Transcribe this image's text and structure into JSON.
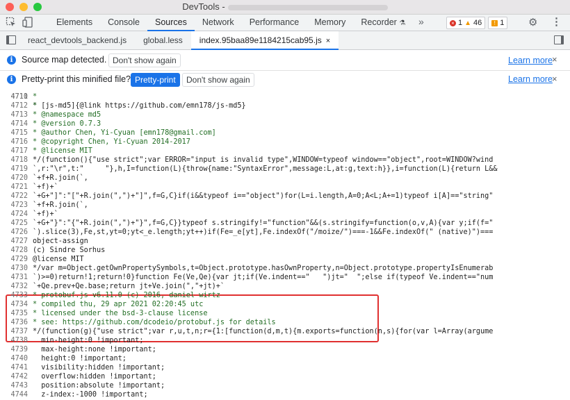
{
  "window": {
    "title": "DevTools -",
    "traffic_lights": [
      "#fd5f57",
      "#febc2e",
      "#28c840"
    ]
  },
  "toolbar": {
    "tabs": [
      "Elements",
      "Console",
      "Sources",
      "Network",
      "Performance",
      "Memory",
      "Recorder"
    ],
    "active_tab": "Sources",
    "more": "»",
    "error_count": "1",
    "warning_count": "46",
    "issue_count": "1"
  },
  "file_tabs": {
    "items": [
      "react_devtools_backend.js",
      "global.less",
      "index.95baa89e1184215cab95.js"
    ],
    "active": "index.95baa89e1184215cab95.js",
    "close": "×"
  },
  "sourcemap_bar": {
    "message": "Source map detected.",
    "dismiss": "Don't show again",
    "learn_more": "Learn more",
    "close": "×"
  },
  "prettyprint_bar": {
    "message": "Pretty-print this minified file?",
    "action": "Pretty-print",
    "dismiss": "Don't show again",
    "learn_more": "Learn more",
    "close": "×"
  },
  "code": {
    "partial_line": "* [js-md5]{@link https://github.com/emn178/js-md5}",
    "lines": [
      {
        "n": "4711",
        "t": "*"
      },
      {
        "n": "4712",
        "t": "*"
      },
      {
        "n": "4713",
        "t": "* @namespace md5"
      },
      {
        "n": "4714",
        "t": "* @version 0.7.3"
      },
      {
        "n": "4715",
        "t": "* @author Chen, Yi-Cyuan [emn178@gmail.com]"
      },
      {
        "n": "4716",
        "t": "* @copyright Chen, Yi-Cyuan 2014-2017"
      },
      {
        "n": "4717",
        "t": "* @license MIT"
      },
      {
        "n": "4718",
        "t": "*/(function(){\"use strict\";var ERROR=\"input is invalid type\",WINDOW=typeof window==\"object\",root=WINDOW?wind"
      },
      {
        "n": "4719",
        "t": "`,r:\"\\r\",t:\"     \"},h,I=function(L){throw{name:\"SyntaxError\",message:L,at:g,text:h}},i=function(L){return L&&"
      },
      {
        "n": "4720",
        "t": "`+f+R.join(`,"
      },
      {
        "n": "4721",
        "t": "`+f)+`"
      },
      {
        "n": "4722",
        "t": "`+G+\"]\":\"[\"+R.join(\",\")+\"]\",f=G,C}if(i&&typeof i==\"object\")for(L=i.length,A=0;A<L;A+=1)typeof i[A]==\"string\""
      },
      {
        "n": "4723",
        "t": "`+f+R.join(`,"
      },
      {
        "n": "4724",
        "t": "`+f)+`"
      },
      {
        "n": "4725",
        "t": "`+G+\"}\":\"{\"+R.join(\",\")+\"}\",f=G,C}}typeof s.stringify!=\"function\"&&(s.stringify=function(o,v,A){var y;if(f=\""
      },
      {
        "n": "4726",
        "t": "`).slice(3),Fe,st,yt=0;yt<_e.length;yt++)if(Fe=_e[yt],Fe.indexOf(\"/moize/\")===-1&&Fe.indexOf(\" (native)\")==="
      },
      {
        "n": "4727",
        "t": "object-assign"
      },
      {
        "n": "4728",
        "t": "(c) Sindre Sorhus"
      },
      {
        "n": "4729",
        "t": "@license MIT"
      },
      {
        "n": "4730",
        "t": "*/var m=Object.getOwnPropertySymbols,t=Object.prototype.hasOwnProperty,n=Object.prototype.propertyIsEnumerab"
      },
      {
        "n": "4731",
        "t": "`)>=0)return!1;return!0}function Fe(Ve,Qe){var jt;if(Ve.indent==\"   \")jt=\"  \";else if(typeof Ve.indent==\"num"
      },
      {
        "n": "4732",
        "t": "`+Qe.prev+Qe.base;return jt+Ve.join(\",\"+jt)+`"
      },
      {
        "n": "4733",
        "t": "* protobuf.js v6.11.0 (c) 2016, daniel wirtz"
      },
      {
        "n": "4734",
        "t": "* compiled thu, 29 apr 2021 02:20:45 utc"
      },
      {
        "n": "4735",
        "t": "* licensed under the bsd-3-clause license"
      },
      {
        "n": "4736",
        "t": "* see: https://github.com/dcodeio/protobuf.js for details"
      },
      {
        "n": "4737",
        "t": "*/(function(g){\"use strict\";var r,u,t,n;r={1:[function(d,m,t){m.exports=function(n,s){for(var l=Array(argume"
      },
      {
        "n": "4738",
        "t": "  min-height:0 !important;"
      },
      {
        "n": "4739",
        "t": "  max-height:none !important;"
      },
      {
        "n": "4740",
        "t": "  height:0 !important;"
      },
      {
        "n": "4741",
        "t": "  visibility:hidden !important;"
      },
      {
        "n": "4742",
        "t": "  overflow:hidden !important;"
      },
      {
        "n": "4743",
        "t": "  position:absolute !important;"
      },
      {
        "n": "4744",
        "t": "  z-index:-1000 !important;"
      }
    ]
  }
}
